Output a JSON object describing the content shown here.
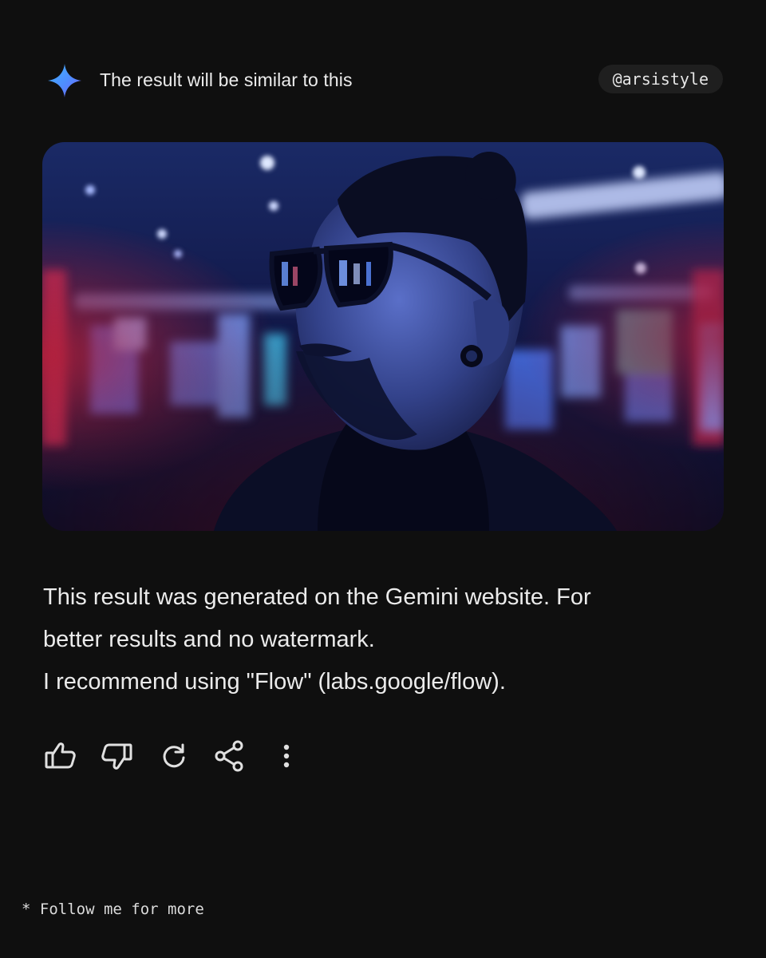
{
  "header": {
    "title": "The result will be similar to this",
    "handle": "@arsistyle",
    "spark_icon": "gemini-spark-icon",
    "spark_colors": [
      "#4f8cff",
      "#7a5cff",
      "#3fb5ff"
    ]
  },
  "image": {
    "description_icon": "generated-portrait-image"
  },
  "message": {
    "line1": "This result was generated on the Gemini website. For",
    "line2": "better results and no watermark.",
    "line3": "I recommend using \"Flow\" (labs.google/flow)."
  },
  "actions": {
    "icons": [
      "thumbs-up-icon",
      "thumbs-down-icon",
      "regenerate-icon",
      "share-icon",
      "more-vert-icon"
    ]
  },
  "footer": {
    "text": "* Follow me for more"
  }
}
